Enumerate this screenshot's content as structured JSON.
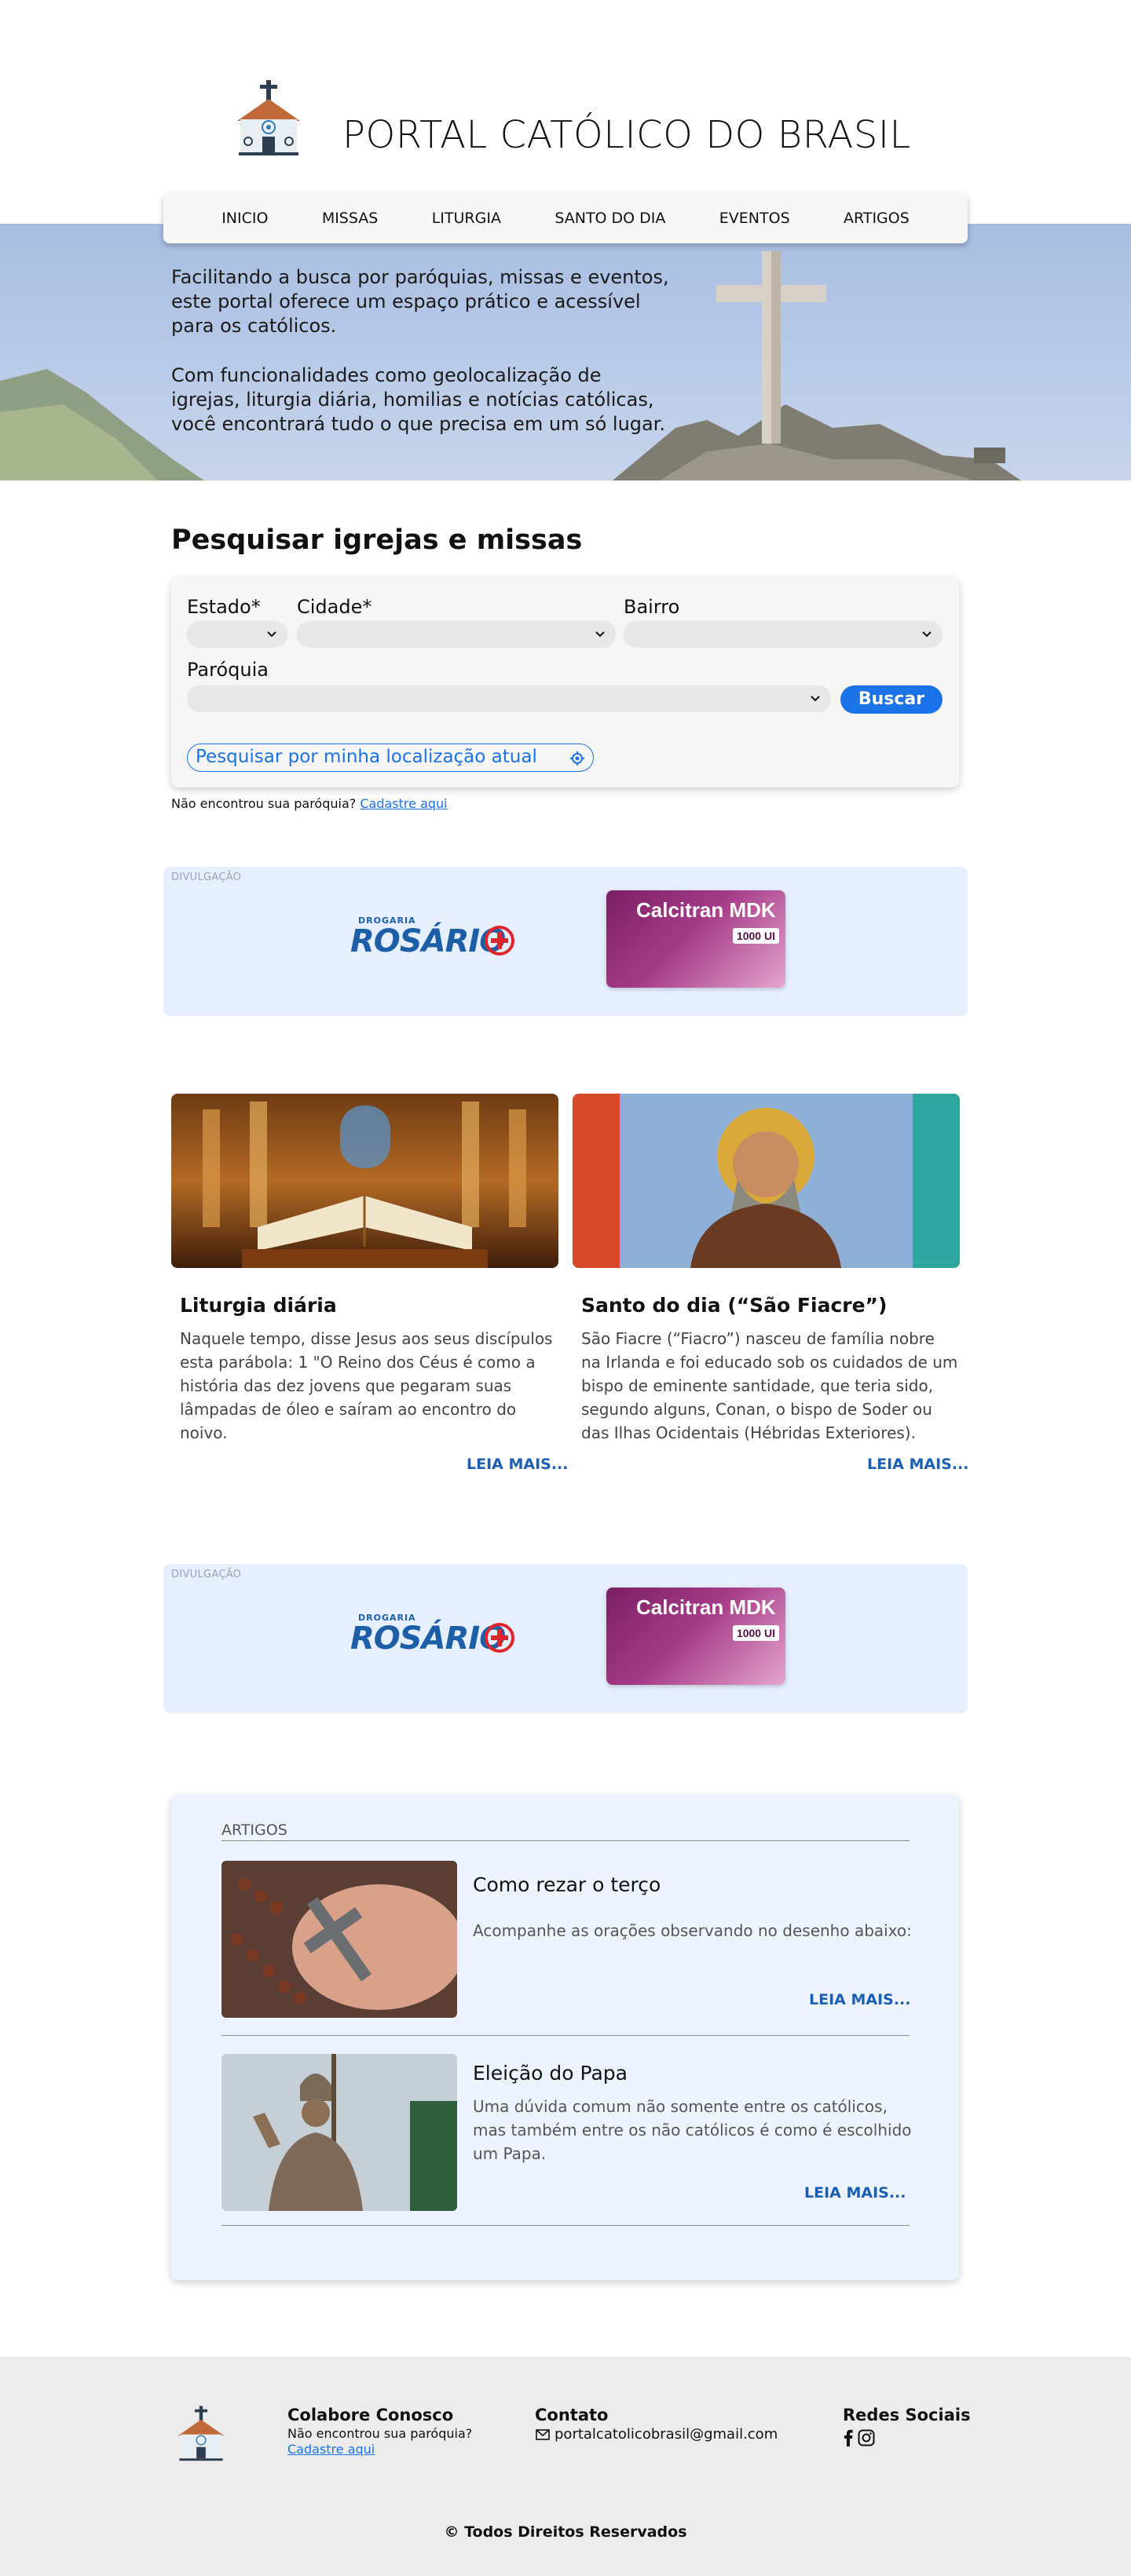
{
  "header": {
    "title": "PORTAL CATÓLICO DO BRASIL",
    "logo_icon": "church-icon"
  },
  "nav": {
    "items": [
      "INICIO",
      "MISSAS",
      "LITURGIA",
      "SANTO DO DIA",
      "EVENTOS",
      "ARTIGOS"
    ]
  },
  "hero": {
    "paragraph1": "Facilitando a busca por paróquias, missas e eventos, este portal oferece um espaço prático e acessível para os católicos.",
    "paragraph2": "Com funcionalidades como geolocalização de igrejas, liturgia diária, homilias e notícias católicas, você encontrará tudo o que precisa em um só lugar."
  },
  "search": {
    "title": "Pesquisar igrejas e missas",
    "estado_label": "Estado*",
    "cidade_label": "Cidade*",
    "bairro_label": "Bairro",
    "paroquia_label": "Paróquia",
    "estado_value": "",
    "cidade_value": "",
    "bairro_value": "",
    "paroquia_value": "",
    "buscar_label": "Buscar",
    "geo_label": "Pesquisar por minha localização atual",
    "notfound_text": "Não encontrou sua paróquia?",
    "notfound_link": "Cadastre aqui"
  },
  "ads": [
    {
      "label": "DIVULGAÇÃO",
      "logo_top": "DROGARIA",
      "logo_main": "ROSÁRIO",
      "product_brand": "Calcitran MDK",
      "product_dose": "1000 UI"
    },
    {
      "label": "DIVULGAÇÃO",
      "logo_top": "DROGARIA",
      "logo_main": "ROSÁRIO",
      "product_brand": "Calcitran MDK",
      "product_dose": "1000 UI"
    }
  ],
  "cards": [
    {
      "title": "Liturgia diária",
      "text": "Naquele tempo, disse Jesus aos seus discípulos esta parábola: 1 \"O Reino dos Céus é como a história das dez jovens que pegaram suas lâmpadas de óleo e saíram ao encontro do noivo.",
      "link": "LEIA MAIS..."
    },
    {
      "title": "Santo do dia (“São Fiacre”)",
      "text": "São Fiacre (“Fiacro”) nasceu de família nobre na Irlanda e foi educado sob os cuidados de um bispo de eminente santidade, que teria sido, segundo alguns, Conan, o bispo de Soder ou das Ilhas Ocidentais (Hébridas Exteriores).",
      "link": "LEIA MAIS..."
    }
  ],
  "articles": {
    "header": "ARTIGOS",
    "items": [
      {
        "title": "Como rezar o terço",
        "text": "Acompanhe as orações observando no desenho abaixo:",
        "link": "LEIA MAIS..."
      },
      {
        "title": "Eleição do Papa",
        "text": "Uma dúvida comum não somente entre os católicos, mas também entre os não católicos é como é escolhido um Papa.",
        "link": "LEIA MAIS..."
      }
    ]
  },
  "footer": {
    "colabore_title": "Colabore Conosco",
    "colabore_text": "Não encontrou sua paróquia?",
    "colabore_link": "Cadastre aqui",
    "contato_title": "Contato",
    "email": "portalcatolicobrasil@gmail.com",
    "redes_title": "Redes Sociais",
    "social_icons": [
      "facebook-icon",
      "instagram-icon"
    ],
    "copyright": "© Todos Direitos Reservados"
  }
}
